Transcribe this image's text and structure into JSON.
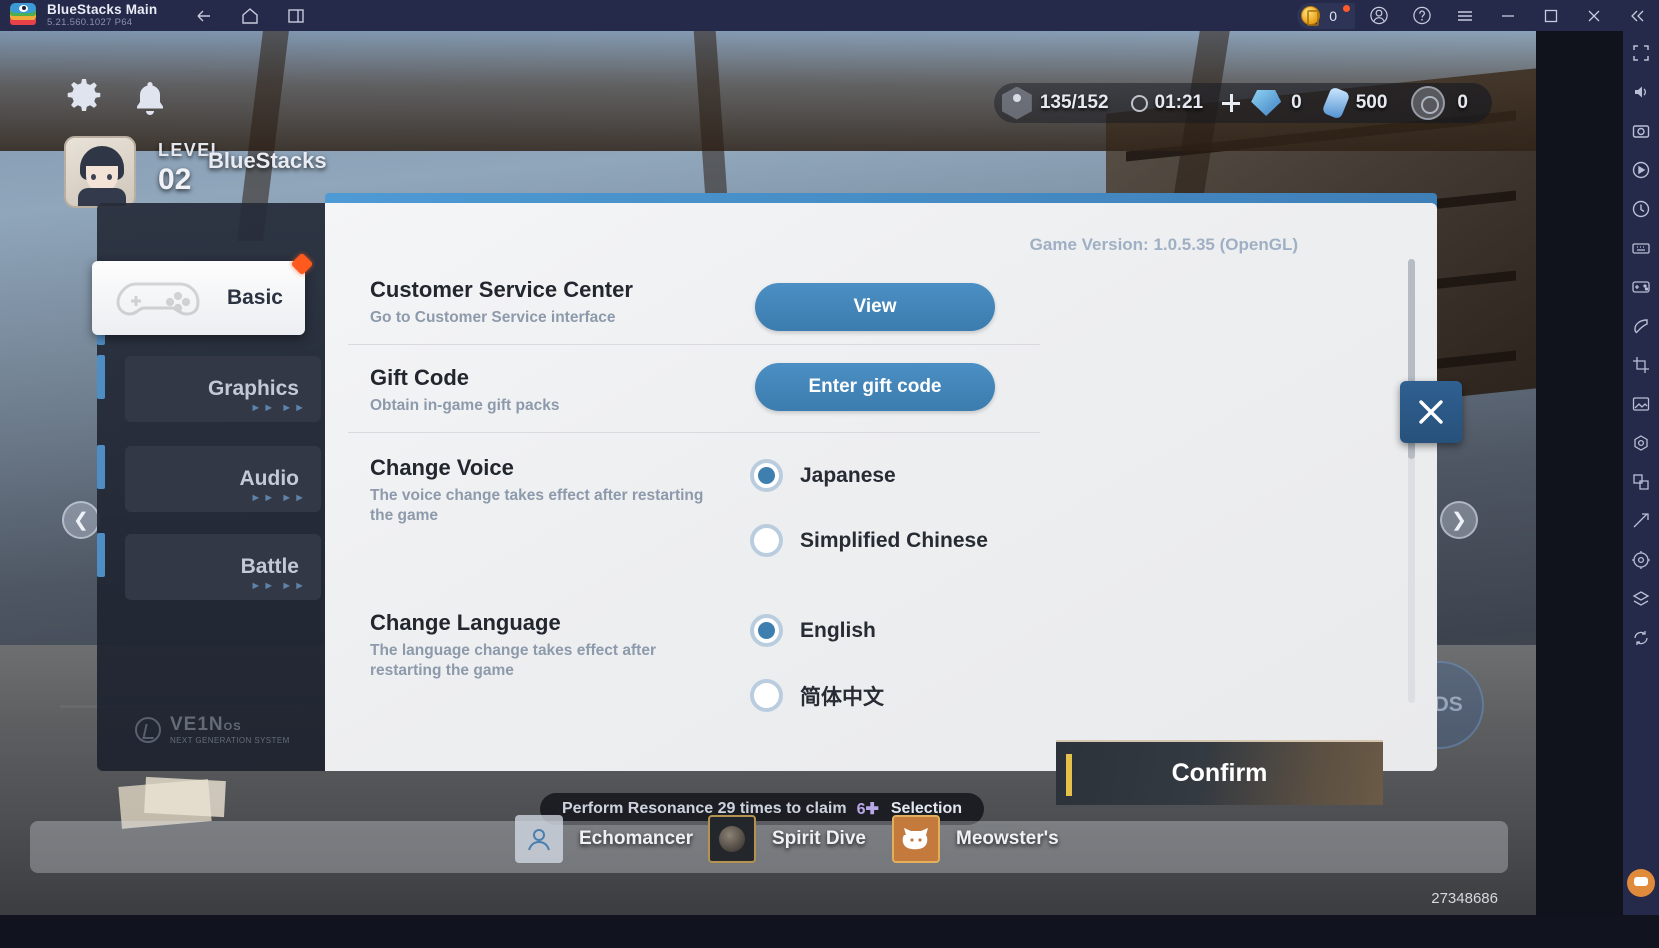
{
  "titlebar": {
    "app_name": "BlueStacks Main",
    "version": "5.21.560.1027  P64",
    "coin_value": "0",
    "icons": [
      "back-arrow-icon",
      "home-icon",
      "multi-instance-icon",
      "account-icon",
      "help-icon",
      "menu-icon",
      "minimize-icon",
      "maximize-icon",
      "close-icon",
      "collapse-icon"
    ]
  },
  "hud": {
    "level_label": "LEVEL",
    "level_value": "02",
    "player_name": "BlueStacks",
    "stamina": "135/152",
    "timer": "01:21",
    "currency_gem": "0",
    "currency_vial": "500",
    "currency_disc": "0"
  },
  "dialog": {
    "game_version": "Game Version: 1.0.5.35 (OpenGL)",
    "close_label": "✕",
    "brand": {
      "name": "VE1N",
      "suffix": "OS",
      "tagline": "NEXT GENERATION SYSTEM"
    },
    "sidebar": {
      "tabs": [
        {
          "label": "Basic",
          "active": true,
          "badge": true
        },
        {
          "label": "Graphics",
          "active": false,
          "badge": false
        },
        {
          "label": "Audio",
          "active": false,
          "badge": false
        },
        {
          "label": "Battle",
          "active": false,
          "badge": false
        }
      ]
    },
    "rows": [
      {
        "title": "Customer Service Center",
        "subtitle": "Go to Customer Service interface",
        "button": "View"
      },
      {
        "title": "Gift Code",
        "subtitle": "Obtain in-game gift packs",
        "button": "Enter gift code"
      },
      {
        "title": "Change Voice",
        "subtitle": "The voice change takes effect after restarting the game",
        "options": [
          {
            "label": "Japanese",
            "selected": true
          },
          {
            "label": "Simplified Chinese",
            "selected": false
          }
        ]
      },
      {
        "title": "Change Language",
        "subtitle": "The language change takes effect after restarting the game",
        "options": [
          {
            "label": "English",
            "selected": true
          },
          {
            "label": "简体中文",
            "selected": false
          }
        ]
      }
    ]
  },
  "confirm_button": "Confirm",
  "quest": {
    "text": "Perform Resonance 29 times to claim",
    "icon_value": "6",
    "suffix": "Selection"
  },
  "bottom_nav": [
    {
      "label": "Echomancer"
    },
    {
      "label": "Spirit Dive"
    },
    {
      "label": "Meowster's"
    }
  ],
  "bottom_number": "27348686",
  "watermark": "ODS",
  "colors": {
    "accent_blue": "#3f7fb0",
    "titlebar": "#252a4a",
    "badge_red": "#ff5a1e",
    "confirm_gold": "#e6c14a"
  }
}
